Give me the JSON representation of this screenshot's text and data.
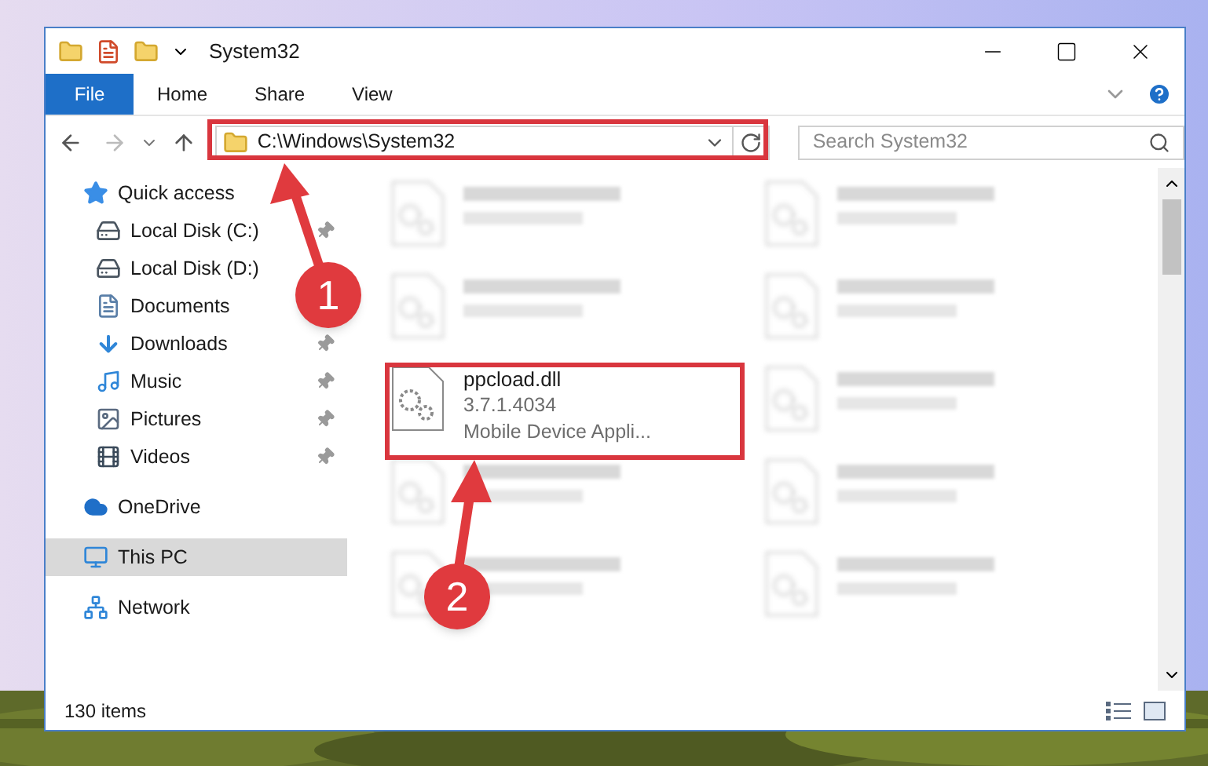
{
  "window": {
    "title": "System32"
  },
  "ribbon_tabs": [
    {
      "label": "File",
      "kind": "file"
    },
    {
      "label": "Home",
      "kind": "tab"
    },
    {
      "label": "Share",
      "kind": "tab"
    },
    {
      "label": "View",
      "kind": "tab"
    }
  ],
  "address_bar": {
    "path": "C:\\Windows\\System32"
  },
  "search": {
    "placeholder": "Search System32"
  },
  "sidebar": {
    "items": [
      {
        "label": "Quick access",
        "kind": "star",
        "selected": false,
        "children": [
          {
            "label": "Local Disk (C:)",
            "kind": "system",
            "pinned": true,
            "selected": false
          },
          {
            "label": "Local Disk (D:)",
            "kind": "drive",
            "pinned": false,
            "selected": false
          },
          {
            "label": "Documents",
            "kind": "documents",
            "pinned": false,
            "selected": false
          },
          {
            "label": "Downloads",
            "kind": "downloads",
            "pinned": true,
            "selected": false
          },
          {
            "label": "Music",
            "kind": "music",
            "pinned": true,
            "selected": false
          },
          {
            "label": "Pictures",
            "kind": "pictures",
            "pinned": true,
            "selected": false
          },
          {
            "label": "Videos",
            "kind": "videos",
            "pinned": true,
            "selected": false
          }
        ]
      },
      {
        "label": "OneDrive",
        "kind": "cloud",
        "selected": false
      },
      {
        "label": "This PC",
        "kind": "computer",
        "selected": true
      },
      {
        "label": "Network",
        "kind": "network",
        "selected": false
      }
    ]
  },
  "files": [
    {
      "kind": "blurred"
    },
    {
      "kind": "blurred"
    },
    {
      "kind": "blurred"
    },
    {
      "kind": "blurred"
    },
    {
      "kind": "file",
      "name": "ppcload.dll",
      "details": [
        "3.7.1.4034",
        "Mobile Device Appli..."
      ]
    },
    {
      "kind": "blurred"
    },
    {
      "kind": "blurred"
    },
    {
      "kind": "blurred"
    },
    {
      "kind": "blurred"
    },
    {
      "kind": "blurred"
    }
  ],
  "status_bar": {
    "item_count": "130 items"
  },
  "annotations": [
    {
      "label": "1"
    },
    {
      "label": "2"
    }
  ]
}
